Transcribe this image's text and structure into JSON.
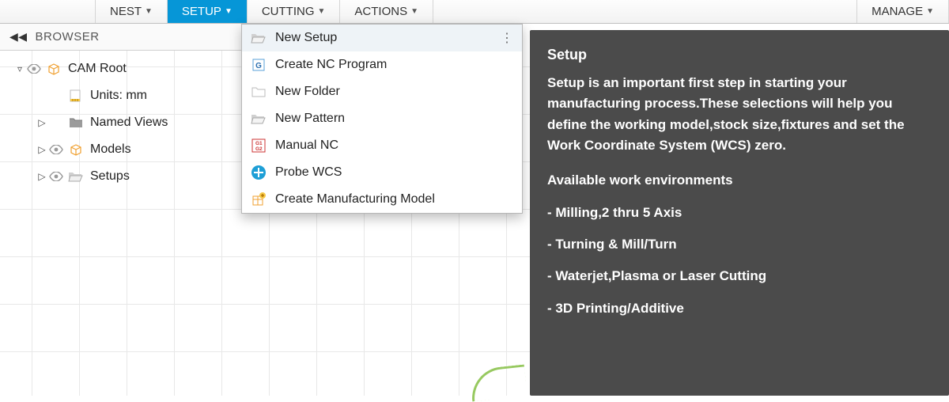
{
  "toolbar": {
    "tabs": [
      {
        "label": "NEST"
      },
      {
        "label": "SETUP",
        "active": true
      },
      {
        "label": "CUTTING"
      },
      {
        "label": "ACTIONS"
      },
      {
        "label": "MANAGE"
      }
    ]
  },
  "browser": {
    "title": "BROWSER",
    "nodes": [
      {
        "label": "CAM Root",
        "level": 0,
        "expander": "▿",
        "eye": true,
        "icon": "component"
      },
      {
        "label": "Units: mm",
        "level": 1,
        "expander": "",
        "eye": false,
        "icon": "ruler"
      },
      {
        "label": "Named Views",
        "level": 1,
        "expander": "▷",
        "eye": false,
        "icon": "folder"
      },
      {
        "label": "Models",
        "level": 1,
        "expander": "▷",
        "eye": true,
        "icon": "component"
      },
      {
        "label": "Setups",
        "level": 1,
        "expander": "▷",
        "eye": true,
        "icon": "folder-open"
      }
    ]
  },
  "menu": {
    "items": [
      {
        "label": "New Setup",
        "icon": "folder-open",
        "hover": true,
        "dots": true
      },
      {
        "label": "Create NC Program",
        "icon": "nc-g"
      },
      {
        "label": "New Folder",
        "icon": "folder"
      },
      {
        "label": "New Pattern",
        "icon": "folder-open"
      },
      {
        "label": "Manual NC",
        "icon": "g1g2"
      },
      {
        "label": "Probe WCS",
        "icon": "probe"
      },
      {
        "label": "Create Manufacturing Model",
        "icon": "mfg-model"
      }
    ]
  },
  "tooltip": {
    "title": "Setup",
    "body": "Setup is an important first step in starting your manufacturing process.These selections will help you define the working model,stock size,fixtures and set the Work Coordinate System (WCS) zero.",
    "subheading": "Available work environments",
    "items": [
      "- Milling,2 thru 5 Axis",
      "- Turning & Mill/Turn",
      "- Waterjet,Plasma or Laser Cutting",
      "- 3D Printing/Additive"
    ]
  }
}
